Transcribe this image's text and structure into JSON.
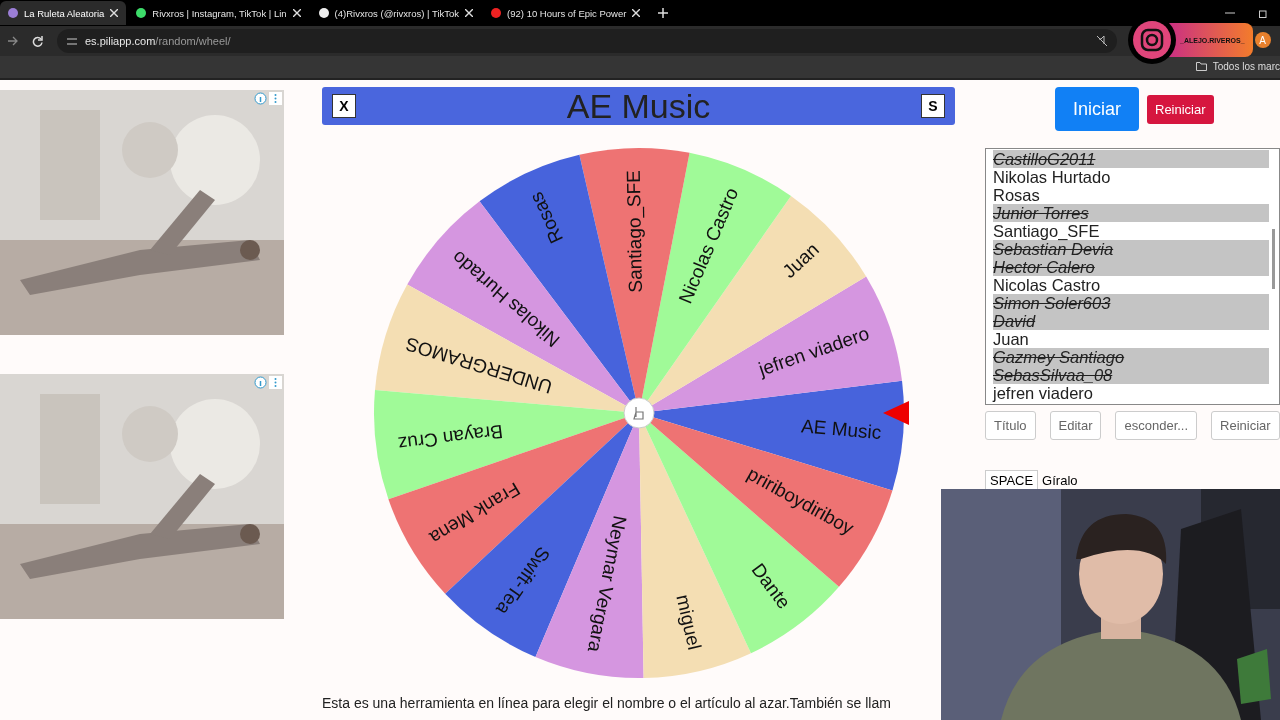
{
  "browser": {
    "tabs": [
      {
        "title": "La Ruleta Aleatoria",
        "selected": true
      },
      {
        "title": "Rivxros | Instagram, TikTok | Lin",
        "selected": false
      },
      {
        "title": "(4)Rivxros (@rivxros) | TikTok",
        "selected": false
      },
      {
        "title": "(92) 10 Hours of Epic Power",
        "selected": false
      }
    ],
    "address": {
      "domain": "es.piliapp.com",
      "path": "/random/wheel/"
    },
    "bookmarks_label": "Todos los marc",
    "profile_initial": "A"
  },
  "overlay": {
    "handle": "_ALEJO.RIVEROS_"
  },
  "wheel_header": {
    "close_label": "X",
    "title": "AE Music",
    "sound_label": "S"
  },
  "wheel": {
    "segments": [
      {
        "name": "AE Music",
        "color": "#4763dc"
      },
      {
        "name": "jefren viadero",
        "color": "#d596e0"
      },
      {
        "name": "Juan",
        "color": "#f4deb3"
      },
      {
        "name": "Nicolas Castro",
        "color": "#a0fa98"
      },
      {
        "name": "Santiago_SFE",
        "color": "#ee7373"
      },
      {
        "name": "Rosas",
        "color": "#4763dc"
      },
      {
        "name": "Nikolas Hurtado",
        "color": "#d596e0"
      },
      {
        "name": "UNDERGRAMOS",
        "color": "#f4deb3"
      },
      {
        "name": "Brayan Cruz",
        "color": "#a0fa98"
      },
      {
        "name": "Frank Mena",
        "color": "#ee7373"
      },
      {
        "name": "Swift-Tea",
        "color": "#4763dc"
      },
      {
        "name": "Neymar Vergara",
        "color": "#d596e0"
      },
      {
        "name": "miguel",
        "color": "#f4deb3"
      },
      {
        "name": "Dante",
        "color": "#a0fa98"
      },
      {
        "name": "pririboydiriboy",
        "color": "#ee7373"
      }
    ]
  },
  "controls": {
    "start": "Iniciar",
    "reset": "Reiniciar"
  },
  "entries": [
    {
      "name": "CastilloG2011",
      "crossed": true
    },
    {
      "name": "Nikolas Hurtado",
      "crossed": false
    },
    {
      "name": "Rosas",
      "crossed": false
    },
    {
      "name": "Junior Torres",
      "crossed": true
    },
    {
      "name": "Santiago_SFE",
      "crossed": false
    },
    {
      "name": "Sebastian Devia",
      "crossed": true
    },
    {
      "name": "Hector Calero",
      "crossed": true
    },
    {
      "name": "Nicolas Castro",
      "crossed": false
    },
    {
      "name": "Simon Soler603",
      "crossed": true
    },
    {
      "name": "David",
      "crossed": true
    },
    {
      "name": "Juan",
      "crossed": false
    },
    {
      "name": "Gazmey Santiago",
      "crossed": true
    },
    {
      "name": "SebasSilvaa_08",
      "crossed": true
    },
    {
      "name": "jefren viadero",
      "crossed": false
    }
  ],
  "list_buttons": [
    "Título",
    "Editar",
    "esconder...",
    "Reiniciar"
  ],
  "shortcut": {
    "key": "SPACE",
    "action": "Gíralo"
  },
  "description": "Esta es una herramienta en línea para elegir el nombre o el artículo al azar.También se llam"
}
